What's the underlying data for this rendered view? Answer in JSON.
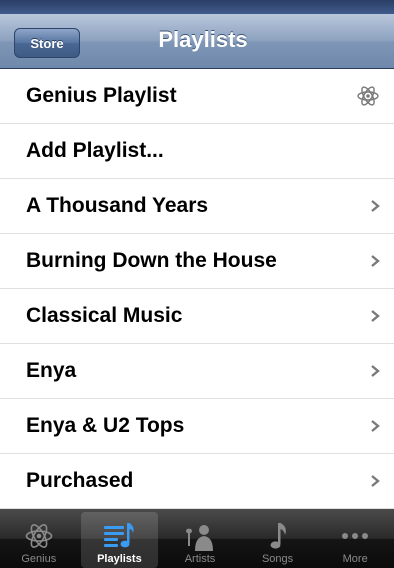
{
  "nav": {
    "store_label": "Store",
    "title": "Playlists"
  },
  "playlists": [
    {
      "label": "Genius Playlist",
      "icon": "genius-icon"
    },
    {
      "label": "Add Playlist...",
      "icon": null
    },
    {
      "label": "A Thousand Years",
      "icon": "chevron-right-icon"
    },
    {
      "label": "Burning Down the House",
      "icon": "chevron-right-icon"
    },
    {
      "label": "Classical Music",
      "icon": "chevron-right-icon"
    },
    {
      "label": "Enya",
      "icon": "chevron-right-icon"
    },
    {
      "label": "Enya & U2 Tops",
      "icon": "chevron-right-icon"
    },
    {
      "label": "Purchased",
      "icon": "chevron-right-icon"
    }
  ],
  "tabs": [
    {
      "label": "Genius",
      "icon": "genius-icon",
      "active": false
    },
    {
      "label": "Playlists",
      "icon": "playlists-icon",
      "active": true
    },
    {
      "label": "Artists",
      "icon": "artists-icon",
      "active": false
    },
    {
      "label": "Songs",
      "icon": "songs-icon",
      "active": false
    },
    {
      "label": "More",
      "icon": "more-icon",
      "active": false
    }
  ],
  "colors": {
    "nav_blue": "#7f96b6",
    "tab_active_blue": "#3a9bf2",
    "tab_inactive": "#8a8a8a"
  }
}
